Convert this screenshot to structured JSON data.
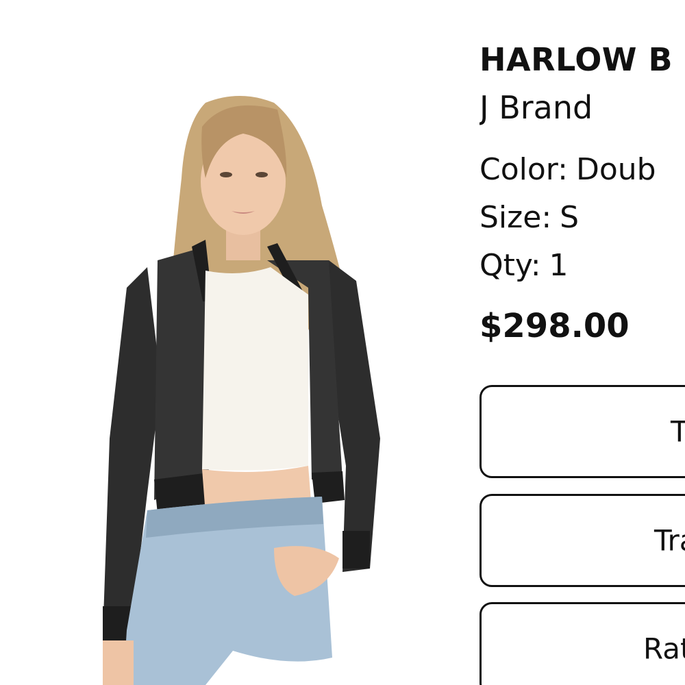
{
  "product": {
    "title": "HARLOW B",
    "brand": "J Brand",
    "color_label": "Color:",
    "color_value": "Doub",
    "size_label": "Size:",
    "size_value": "S",
    "qty_label": "Qty:",
    "qty_value": "1",
    "price": "$298.00"
  },
  "actions": [
    {
      "label": "T"
    },
    {
      "label": "Tra"
    },
    {
      "label": "Rat"
    }
  ],
  "image": {
    "icon": "product-photo-model-cropped-black-denim-jacket"
  },
  "colors": {
    "text": "#111111",
    "background": "#ffffff",
    "button_border": "#111111"
  }
}
